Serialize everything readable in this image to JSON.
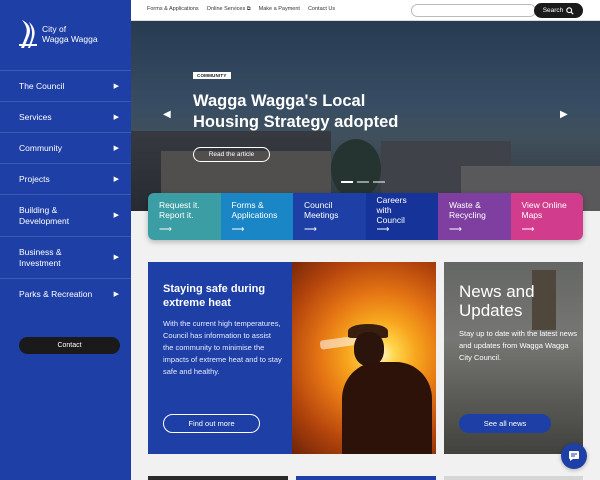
{
  "logo": {
    "line1": "City of",
    "line2": "Wagga Wagga"
  },
  "sidebar": {
    "items": [
      {
        "label": "The Council"
      },
      {
        "label": "Services"
      },
      {
        "label": "Community"
      },
      {
        "label": "Projects"
      },
      {
        "label": "Building & Development"
      },
      {
        "label": "Business & Investment"
      },
      {
        "label": "Parks & Recreation"
      }
    ],
    "contact_label": "Contact"
  },
  "topbar": {
    "links": [
      "Forms & Applications",
      "Online Services",
      "Make a Payment",
      "Contact Us"
    ],
    "search_placeholder": "",
    "search_label": "Search"
  },
  "hero": {
    "tag": "COMMUNITY",
    "title": "Wagga Wagga's Local Housing Strategy adopted",
    "button": "Read the article"
  },
  "tiles": [
    {
      "label": "Request it. Report it.",
      "color": "#3a9ea4"
    },
    {
      "label": "Forms & Applications",
      "color": "#1b86c6"
    },
    {
      "label": "Council Meetings",
      "color": "#1e3fa6"
    },
    {
      "label": "Careers with Council",
      "color": "#16339a"
    },
    {
      "label": "Waste & Recycling",
      "color": "#7f3fa1"
    },
    {
      "label": "View Online Maps",
      "color": "#d13c8c"
    }
  ],
  "heat": {
    "title": "Staying safe during extreme heat",
    "body": "With the current high temperatures, Council has information to assist the community to minimise the impacts of extreme heat and to stay safe and healthy.",
    "button": "Find out more"
  },
  "news": {
    "title": "News and Updates",
    "body": "Stay up to date with the latest news and updates from Wagga Wagga City Council.",
    "button": "See all news"
  },
  "icons": {
    "logo": "city-logo-icon",
    "search": "search-icon",
    "external": "external-link-icon",
    "chat": "chat-icon",
    "chevron": "chevron-right-icon"
  }
}
